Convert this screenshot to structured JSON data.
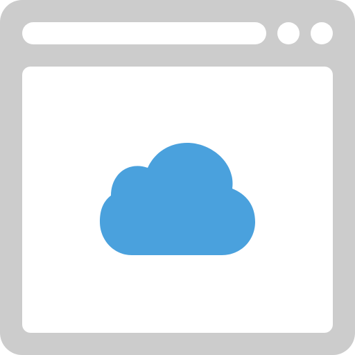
{
  "icon": {
    "name": "browser-cloud-icon",
    "frame_color": "#cccccc",
    "content_color": "#ffffff",
    "cloud_color": "#4aa1dd",
    "window_buttons": [
      "window-dot",
      "window-dot"
    ]
  }
}
